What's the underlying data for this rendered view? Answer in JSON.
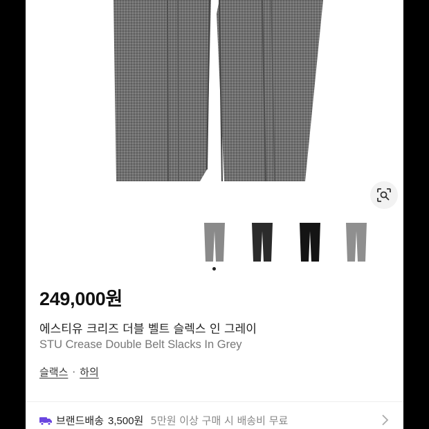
{
  "product": {
    "price": "249,000원",
    "name_ko": "에스티유 크리즈 더블 벨트 슬렉스 인 그레이",
    "name_en": "STU Crease Double Belt Slacks In Grey"
  },
  "categories": [
    {
      "label": "슬랙스"
    },
    {
      "label": "하의"
    }
  ],
  "category_separator": "·",
  "shipping": {
    "title": "브랜드배송",
    "fee": "3,500원",
    "condition": "5만원 이상 구매 시 배송비 무료"
  },
  "thumbnails": [
    {
      "color": "#8a8a8a",
      "active": true
    },
    {
      "color": "#2b2b2b",
      "active": false
    },
    {
      "color": "#141414",
      "active": false
    },
    {
      "color": "#8f8f8f",
      "active": false
    }
  ],
  "colors": {
    "shipping_icon": "#6b46e0",
    "hero_fabric": "#6e6e6e"
  },
  "icons": {
    "lens": "lens-search-icon",
    "truck": "truck-icon",
    "chevron": "chevron-right-icon"
  }
}
